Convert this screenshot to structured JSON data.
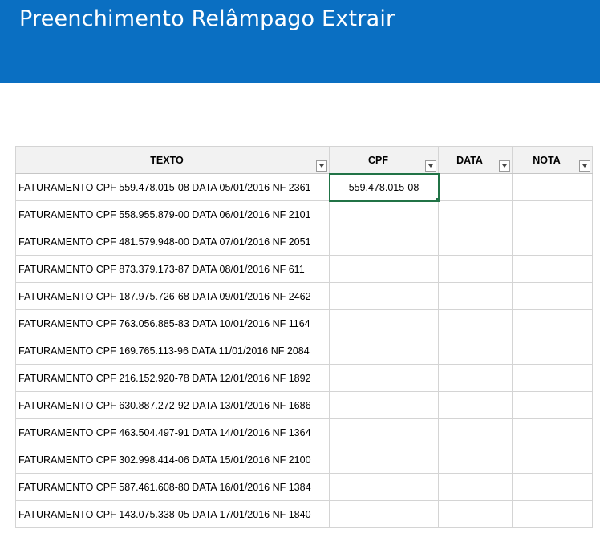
{
  "banner": {
    "title": "Preenchimento Relâmpago Extrair",
    "color": "#0a6fc2"
  },
  "table": {
    "headers": {
      "texto": "TEXTO",
      "cpf": "CPF",
      "data": "DATA",
      "nota": "NOTA"
    },
    "rows": [
      {
        "texto": "FATURAMENTO CPF 559.478.015-08 DATA 05/01/2016 NF 2361",
        "cpf": "559.478.015-08",
        "data": "",
        "nota": ""
      },
      {
        "texto": "FATURAMENTO CPF 558.955.879-00 DATA 06/01/2016 NF 2101",
        "cpf": "",
        "data": "",
        "nota": ""
      },
      {
        "texto": "FATURAMENTO CPF 481.579.948-00 DATA 07/01/2016 NF 2051",
        "cpf": "",
        "data": "",
        "nota": ""
      },
      {
        "texto": "FATURAMENTO CPF 873.379.173-87 DATA 08/01/2016 NF 611",
        "cpf": "",
        "data": "",
        "nota": ""
      },
      {
        "texto": "FATURAMENTO CPF 187.975.726-68 DATA 09/01/2016 NF 2462",
        "cpf": "",
        "data": "",
        "nota": ""
      },
      {
        "texto": "FATURAMENTO CPF 763.056.885-83 DATA 10/01/2016 NF 1164",
        "cpf": "",
        "data": "",
        "nota": ""
      },
      {
        "texto": "FATURAMENTO CPF 169.765.113-96 DATA 11/01/2016 NF 2084",
        "cpf": "",
        "data": "",
        "nota": ""
      },
      {
        "texto": "FATURAMENTO CPF 216.152.920-78 DATA 12/01/2016 NF 1892",
        "cpf": "",
        "data": "",
        "nota": ""
      },
      {
        "texto": "FATURAMENTO CPF 630.887.272-92 DATA 13/01/2016 NF 1686",
        "cpf": "",
        "data": "",
        "nota": ""
      },
      {
        "texto": "FATURAMENTO CPF 463.504.497-91 DATA 14/01/2016 NF 1364",
        "cpf": "",
        "data": "",
        "nota": ""
      },
      {
        "texto": "FATURAMENTO CPF 302.998.414-06 DATA 15/01/2016 NF 2100",
        "cpf": "",
        "data": "",
        "nota": ""
      },
      {
        "texto": "FATURAMENTO CPF 587.461.608-80 DATA 16/01/2016 NF 1384",
        "cpf": "",
        "data": "",
        "nota": ""
      },
      {
        "texto": "FATURAMENTO CPF 143.075.338-05 DATA 17/01/2016 NF 1840",
        "cpf": "",
        "data": "",
        "nota": ""
      }
    ],
    "selection_color": "#217346"
  }
}
